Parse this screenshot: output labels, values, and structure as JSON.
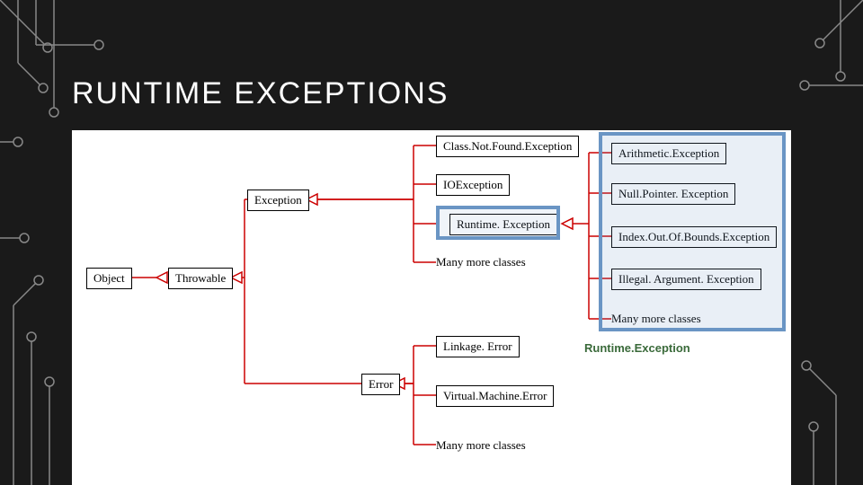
{
  "title": "RUNTIME EXCEPTIONS",
  "caption": "Runtime.Exception",
  "nodes": {
    "object": "Object",
    "throwable": "Throwable",
    "exception": "Exception",
    "error": "Error",
    "classnotfound": "Class.Not.Found.Exception",
    "ioexception": "IOException",
    "runtimeex": "Runtime. Exception",
    "more1": "Many more classes",
    "linkage": "Linkage. Error",
    "vmerror": "Virtual.Machine.Error",
    "more2": "Many more classes",
    "arithmetic": "Arithmetic.Exception",
    "nullpointer": "Null.Pointer. Exception",
    "indexoob": "Index.Out.Of.Bounds.Exception",
    "illegal": "Illegal. Argument. Exception",
    "more3": "Many more classes"
  }
}
